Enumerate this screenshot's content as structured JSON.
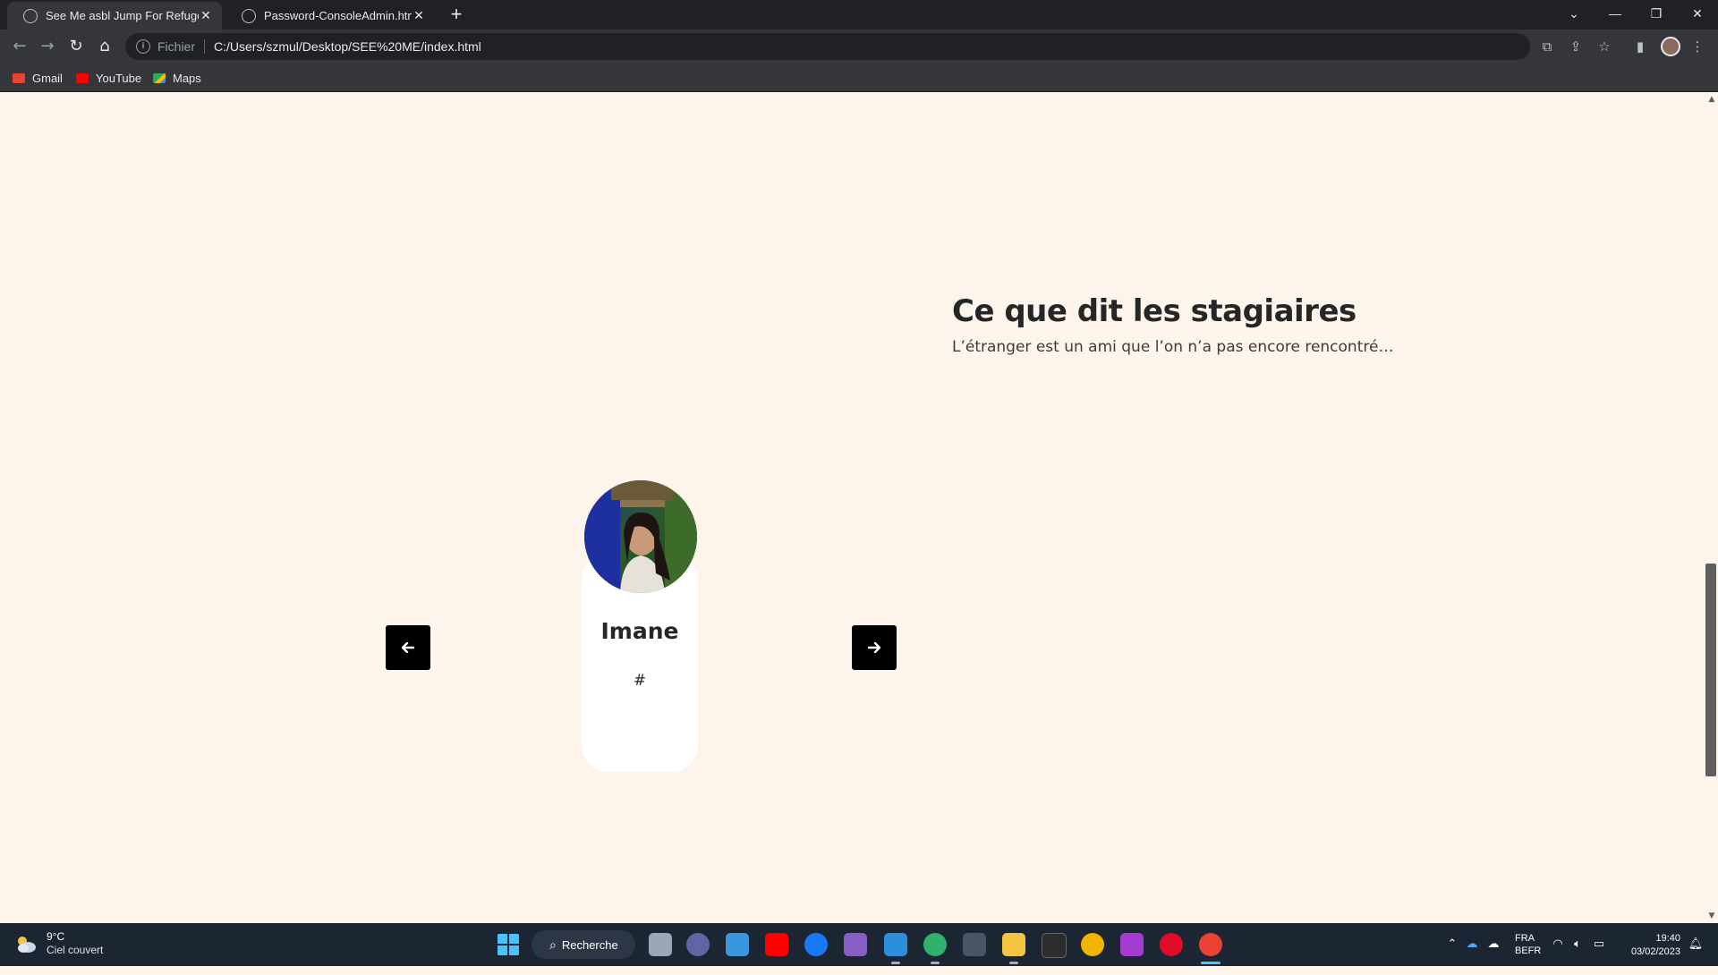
{
  "browser": {
    "tabs": [
      {
        "title": "See Me asbl Jump For Refugees",
        "active": true
      },
      {
        "title": "Password-ConsoleAdmin.html",
        "active": false
      }
    ],
    "address": {
      "scheme_label": "Fichier",
      "url": "C:/Users/szmul/Desktop/SEE%20ME/index.html"
    },
    "bookmarks": [
      {
        "label": "Gmail",
        "icon": "gmail-icon",
        "color": "#ea4335"
      },
      {
        "label": "YouTube",
        "icon": "youtube-icon",
        "color": "#ff0000"
      },
      {
        "label": "Maps",
        "icon": "maps-icon",
        "color": "#34a853"
      }
    ]
  },
  "testimonials": {
    "title": "Ce que dit les stagiaires",
    "subtitle": "L’étranger est un ami que l’on n’a pas encore rencontré…",
    "card": {
      "name": "Imane",
      "role": "#"
    },
    "prev_icon": "arrow-left-icon",
    "next_icon": "arrow-right-icon"
  },
  "taskbar": {
    "weather": {
      "temp": "9°C",
      "condition": "Ciel couvert"
    },
    "search_label": "Recherche",
    "language": {
      "line1": "FRA",
      "line2": "BEFR"
    },
    "clock": {
      "time": "19:40",
      "date": "03/02/2023"
    }
  },
  "colors": {
    "page_background": "#fdf4ec",
    "heading": "#262626",
    "button": "#000000",
    "card": "#ffffff"
  }
}
